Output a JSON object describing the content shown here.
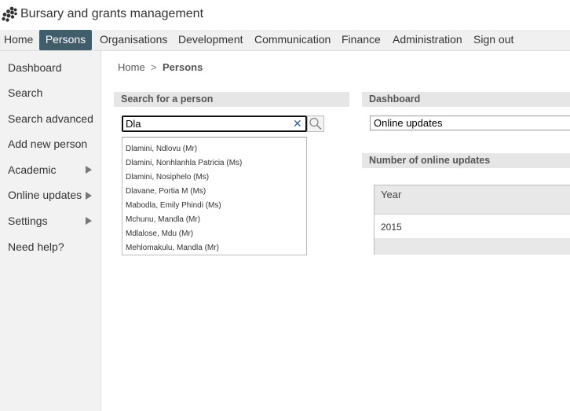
{
  "app": {
    "title": "Bursary and grants management"
  },
  "nav": {
    "items": [
      {
        "label": "Home",
        "active": false
      },
      {
        "label": "Persons",
        "active": true
      },
      {
        "label": "Organisations",
        "active": false
      },
      {
        "label": "Development",
        "active": false
      },
      {
        "label": "Communication",
        "active": false
      },
      {
        "label": "Finance",
        "active": false
      },
      {
        "label": "Administration",
        "active": false
      },
      {
        "label": "Sign out",
        "active": false
      }
    ],
    "active_color": "#3f5d6b"
  },
  "sidebar": {
    "items": [
      {
        "label": "Dashboard",
        "has_submenu": false
      },
      {
        "label": "Search",
        "has_submenu": false
      },
      {
        "label": "Search advanced",
        "has_submenu": false
      },
      {
        "label": "Add new person",
        "has_submenu": false
      },
      {
        "label": "Academic",
        "has_submenu": true
      },
      {
        "label": "Online updates",
        "has_submenu": true
      },
      {
        "label": "Settings",
        "has_submenu": true
      },
      {
        "label": "Need help?",
        "has_submenu": false
      }
    ]
  },
  "breadcrumb": {
    "home": "Home",
    "separator": ">",
    "current": "Persons"
  },
  "search_panel": {
    "heading": "Search for a person",
    "input_value": "Dla",
    "clear_icon": "close-icon",
    "search_icon": "search-icon",
    "suggestions": [
      "Dlamini, Ndlovu (Mr)",
      "Dlamini, Nonhlanhla Patricia (Ms)",
      "Dlamini, Nosiphelo (Ms)",
      "Dlavane, Portia M (Ms)",
      "Mabodla, Emily Phindi (Ms)",
      "Mchunu, Mandla (Mr)",
      "Mdlalose, Mdu (Mr)",
      "Mehlomakulu, Mandla (Mr)"
    ]
  },
  "dashboard_panel": {
    "heading": "Dashboard",
    "selected": "Online updates"
  },
  "online_updates_panel": {
    "heading": "Number of online updates",
    "table": {
      "columns": [
        "Year"
      ],
      "rows": [
        [
          "2015"
        ]
      ]
    }
  }
}
